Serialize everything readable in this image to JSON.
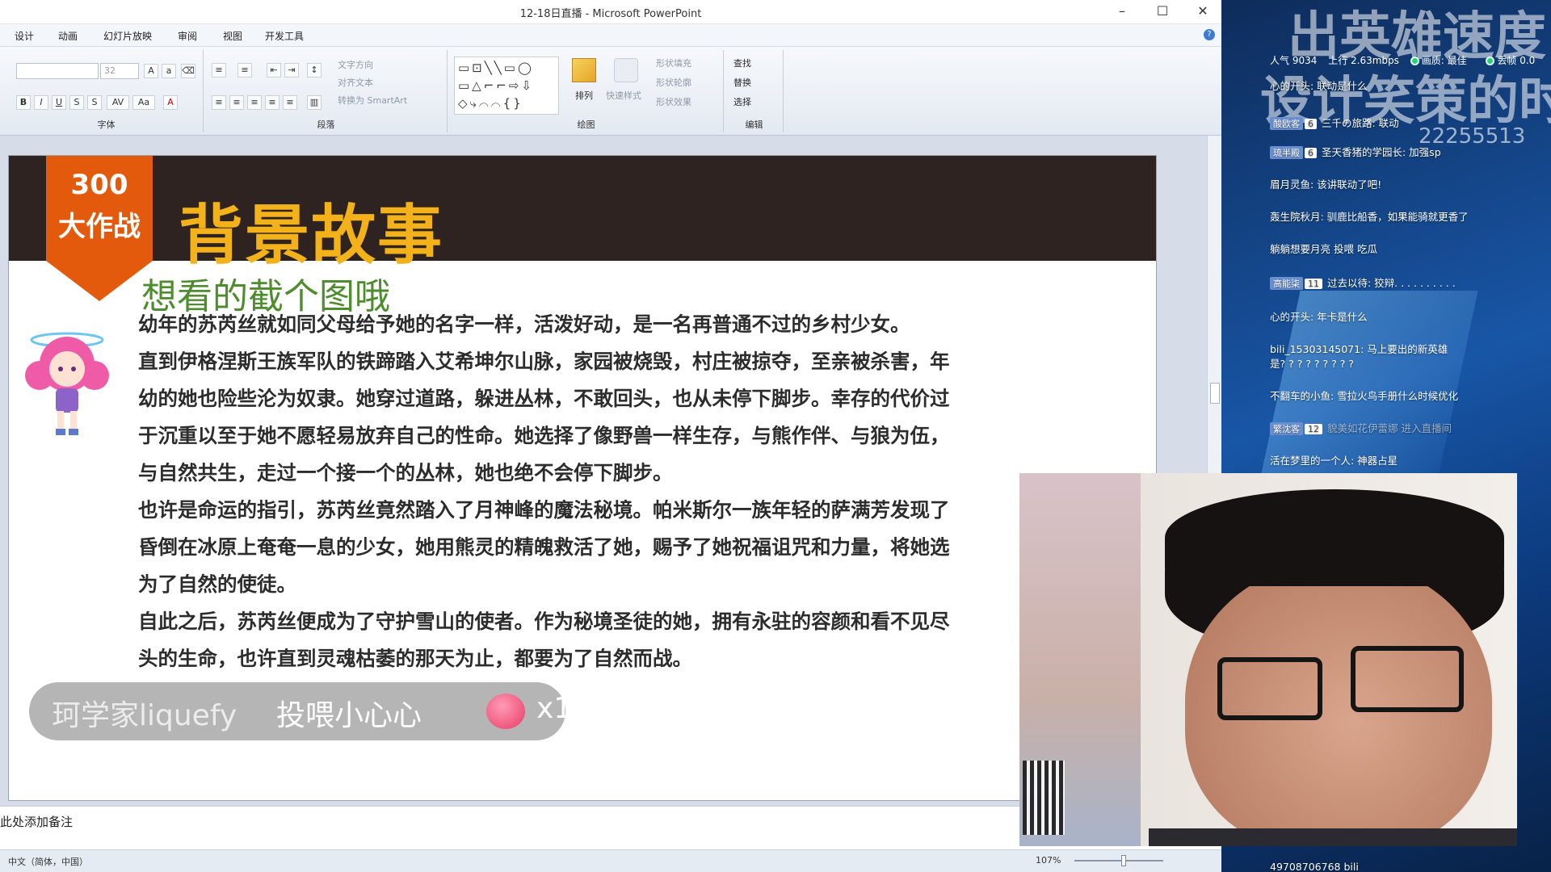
{
  "window": {
    "title": "12-18日直播 - Microsoft PowerPoint",
    "minimize": "–",
    "maximize": "☐",
    "close": "✕"
  },
  "menu": [
    "设计",
    "动画",
    "幻灯片放映",
    "审阅",
    "视图",
    "开发工具"
  ],
  "help_icon": "?",
  "ribbon": {
    "font_group_label": "字体",
    "font_size": "32",
    "paragraph_group_label": "段落",
    "text_direction": "文字方向",
    "align_text": "对齐文本",
    "convert_smartart": "转换为 SmartArt",
    "drawing_group_label": "绘图",
    "arrange": "排列",
    "quick_styles": "快速样式",
    "shape_fill": "形状填充",
    "shape_outline": "形状轮廓",
    "shape_effects": "形状效果",
    "edit_group_label": "编辑",
    "find": "查找",
    "replace": "替换",
    "select": "选择"
  },
  "slide": {
    "badge_number": "300",
    "badge_text": "大作战",
    "heading": "背景故事",
    "subtitle": "想看的截个图哦",
    "paragraphs": [
      "幼年的苏芮丝就如同父母给予她的名字一样，活泼好动，是一名再普通不过的乡村少女。",
      "直到伊格涅斯王族军队的铁蹄踏入艾希坤尔山脉，家园被烧毁，村庄被掠夺，至亲被杀害，年幼的她也险些沦为奴隶。她穿过道路，躲进丛林，不敢回头，也从未停下脚步。幸存的代价过于沉重以至于她不愿轻易放弃自己的性命。她选择了像野兽一样生存，与熊作伴、与狼为伍，与自然共生，走过一个接一个的丛林，她也绝不会停下脚步。",
      "也许是命运的指引，苏芮丝竟然踏入了月神峰的魔法秘境。帕米斯尔一族年轻的萨满芳发现了昏倒在冰原上奄奄一息的少女，她用熊灵的精魄救活了她，赐予了她祝福诅咒和力量，将她选为了自然的使徒。",
      "自此之后，苏芮丝便成为了守护雪山的使者。作为秘境圣徒的她，拥有永驻的容颜和看不见尽头的生命，也许直到灵魂枯萎的那天为止，都要为了自然而战。"
    ]
  },
  "notes": "此处添加备注",
  "status": {
    "language": "中文（简体，中国）",
    "zoom": "107%"
  },
  "gift": {
    "user": "珂学家liquefy",
    "action": "投喂小心心",
    "count": "x1"
  },
  "stream": {
    "watermark_line1": "出英雄速度",
    "watermark_line2": "设计笑策的时",
    "room_id": "22255513",
    "popularity": "人气 9034",
    "upload": "上行 2.63mbps",
    "quality": "画质: 最佳",
    "frame_loss": "丢帧 0.0"
  },
  "chat": [
    {
      "badge": "",
      "level": "",
      "text": "心的开头: 联动是什么",
      "dim": false
    },
    {
      "badge": "酸欧客",
      "level": "6",
      "text": "三千の旅路: 联动",
      "dim": false
    },
    {
      "badge": "琉半殿",
      "level": "6",
      "text": "圣天香猪的学园长: 加强sp",
      "dim": false
    },
    {
      "badge": "",
      "level": "",
      "text": "眉月灵鱼: 该讲联动了吧!",
      "dim": false
    },
    {
      "badge": "",
      "level": "",
      "text": "轰生院秋月: 驯鹿比船香，如果能骑就更香了",
      "dim": false
    },
    {
      "badge": "",
      "level": "",
      "text": "躺躺想要月亮 投喂 吃瓜",
      "dim": false
    },
    {
      "badge": "高能柒",
      "level": "11",
      "text": "过去以待: 狡辩. . .   . . . . . . .",
      "dim": false
    },
    {
      "badge": "",
      "level": "",
      "text": "心的开头: 年卡是什么",
      "dim": false
    },
    {
      "badge": "",
      "level": "",
      "text": "bili_15303145071: 马上要出的新英雄",
      "dim": false
    },
    {
      "badge": "",
      "level": "",
      "text": "是? ? ? ? ? ? ? ? ?",
      "dim": false
    },
    {
      "badge": "",
      "level": "",
      "text": "不翻车的小鱼: 雪拉火鸟手册什么时候优化",
      "dim": false
    },
    {
      "badge": "繁沈客",
      "level": "12",
      "text": "貌美如花伊蕾娜 进入直播间",
      "dim": true
    },
    {
      "badge": "",
      "level": "",
      "text": "活在梦里的一个人: 神器占星",
      "dim": false
    },
    {
      "badge": "",
      "level": "",
      "text": "49708706768 bili",
      "dim": false
    }
  ]
}
